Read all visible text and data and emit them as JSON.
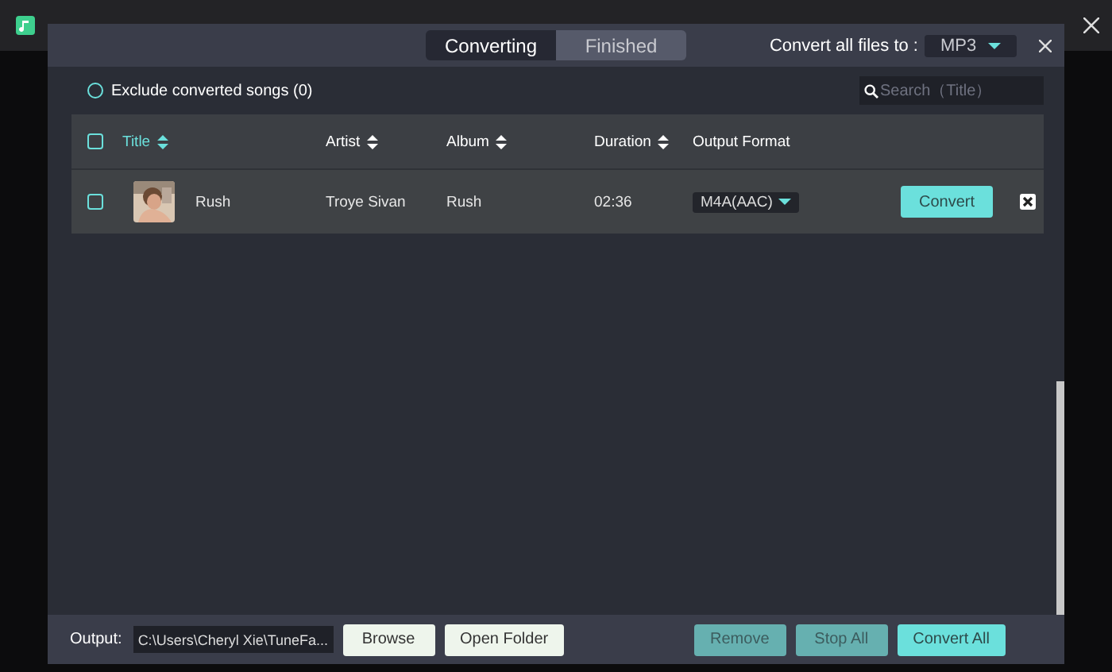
{
  "tabs": [
    {
      "label": "Converting",
      "selected": true
    },
    {
      "label": "Finished",
      "selected": false
    }
  ],
  "convert_all": {
    "label": "Convert all files to :",
    "value": "MP3"
  },
  "exclude": {
    "label": "Exclude converted songs (0)",
    "checked": false
  },
  "search": {
    "placeholder": "Search（Title）"
  },
  "table": {
    "select_all": false,
    "columns": [
      {
        "label": "Title",
        "sortable": true,
        "active": true
      },
      {
        "label": "Artist",
        "sortable": true,
        "active": false
      },
      {
        "label": "Album",
        "sortable": true,
        "active": false
      },
      {
        "label": "Duration",
        "sortable": true,
        "active": false
      },
      {
        "label": "Output Format",
        "sortable": false,
        "active": false
      }
    ],
    "rows": [
      {
        "selected": false,
        "title": "Rush",
        "artist": "Troye Sivan",
        "album": "Rush",
        "duration": "02:36",
        "format": "M4A(AAC)",
        "action": "Convert"
      }
    ]
  },
  "footer": {
    "output_label": "Output:",
    "path": "C:\\Users\\Cheryl Xie\\TuneFa...",
    "buttons": [
      {
        "label": "Browse",
        "kind": "light"
      },
      {
        "label": "Open Folder",
        "kind": "light"
      },
      {
        "label": "Remove",
        "kind": "muted"
      },
      {
        "label": "Stop All",
        "kind": "muted"
      },
      {
        "label": "Convert All",
        "kind": "primary"
      }
    ]
  }
}
